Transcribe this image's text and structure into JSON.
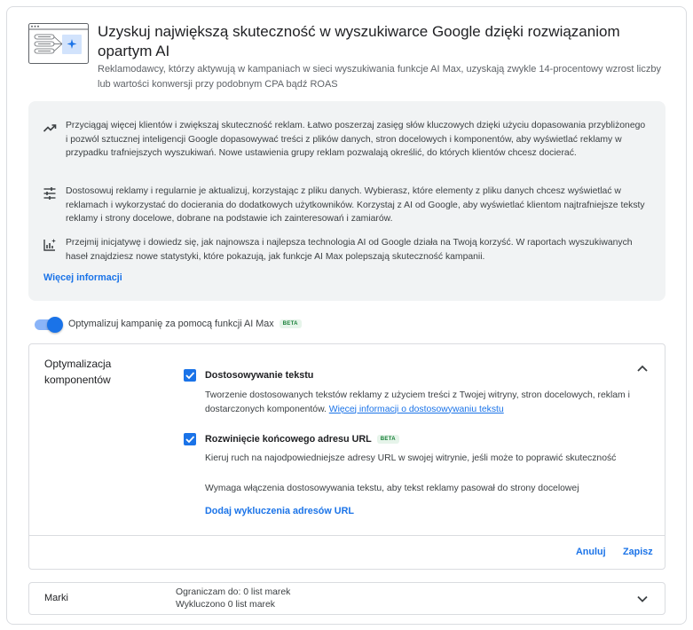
{
  "header": {
    "title": "Uzyskuj największą skuteczność w wyszukiwarce Google dzięki rozwiązaniom opartym AI",
    "subtitle": "Reklamodawcy, którzy aktywują w kampaniach w sieci wyszukiwania funkcje AI Max, uzyskają zwykle 14-procentowy wzrost liczby lub wartości konwersji przy podobnym CPA bądź ROAS",
    "illustration_icon": "search-ai-illustration-icon"
  },
  "info": {
    "items": [
      {
        "icon": "trending-up-icon",
        "text": "Przyciągaj więcej klientów i zwiększaj skuteczność reklam. Łatwo poszerzaj zasięg słów kluczowych dzięki użyciu dopasowania przybliżonego i pozwól sztucznej inteligencji Google dopasowywać treści z plików danych, stron docelowych i komponentów, aby wyświetlać reklamy w przypadku trafniejszych wyszukiwań. Nowe ustawienia grupy reklam pozwalają określić, do których klientów chcesz docierać."
      },
      {
        "icon": "tune-icon",
        "text": "Dostosowuj reklamy i regularnie je aktualizuj, korzystając z pliku danych. Wybierasz, które elementy z pliku danych chcesz wyświetlać w reklamach i wykorzystać do docierania do dodatkowych użytkowników. Korzystaj z AI od Google, aby wyświetlać klientom najtrafniejsze teksty reklamy i strony docelowe, dobrane na podstawie ich zainteresowań i zamiarów."
      },
      {
        "icon": "insights-chart-icon",
        "text": "Przejmij inicjatywę i dowiedz się, jak najnowsza i najlepsza technologia AI od Google działa na Twoją korzyść. W raportach wyszukiwanych haseł znajdziesz nowe statystyki, które pokazują, jak funkcje AI Max polepszają skuteczność kampanii."
      }
    ],
    "more_link": "Więcej informacji"
  },
  "toggle": {
    "label": "Optymalizuj kampanię za pomocą funkcji AI Max",
    "badge": "BETA",
    "on": true
  },
  "optimization": {
    "title": "Optymalizacja komponentów",
    "text_customization": {
      "label": "Dostosowywanie tekstu",
      "checked": true,
      "desc": "Tworzenie dostosowanych tekstów reklamy z użyciem treści z Twojej witryny, stron docelowych, reklam i dostarczonych komponentów.",
      "link": "Więcej informacji o dostosowywaniu tekstu"
    },
    "url_expansion": {
      "label": "Rozwinięcie końcowego adresu URL",
      "badge": "BETA",
      "checked": true,
      "desc": "Kieruj ruch na najodpowiedniejsze adresy URL w swojej witrynie, jeśli może to poprawić skuteczność",
      "note": "Wymaga włączenia dostosowywania tekstu, aby tekst reklamy pasował do strony docelowej",
      "link": "Dodaj wykluczenia adresów URL"
    },
    "cancel": "Anuluj",
    "save": "Zapisz"
  },
  "brands": {
    "title": "Marki",
    "limit": "Ograniczam do: 0 list marek",
    "excluded": "Wykluczono 0 list marek"
  },
  "colors": {
    "accent": "#1a73e8",
    "panel_bg": "#f1f3f4",
    "beta_bg": "#e6f4ea",
    "beta_text": "#188038"
  }
}
